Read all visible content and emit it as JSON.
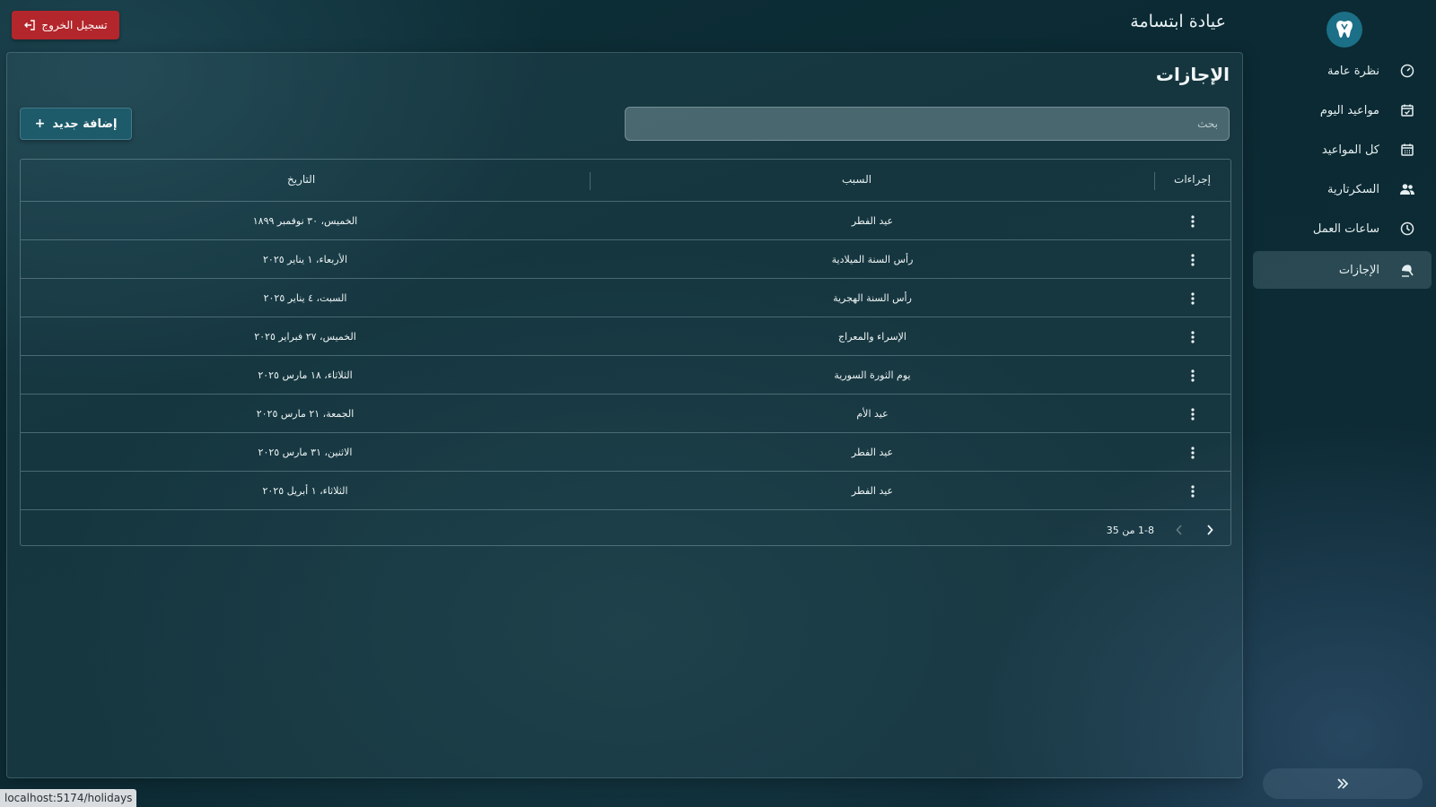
{
  "app": {
    "title": "عيادة ابتسامة",
    "logout_label": "تسجيل الخروج"
  },
  "sidebar": {
    "items": [
      {
        "label": "نظرة عامة",
        "icon": "dashboard-gauge-icon"
      },
      {
        "label": "مواعيد اليوم",
        "icon": "calendar-check-icon"
      },
      {
        "label": "كل المواعيد",
        "icon": "calendar-icon"
      },
      {
        "label": "السكرتارية",
        "icon": "people-icon"
      },
      {
        "label": "ساعات العمل",
        "icon": "clock-icon"
      },
      {
        "label": "الإجازات",
        "icon": "beach-umbrella-icon",
        "active": true
      }
    ]
  },
  "page": {
    "title": "الإجازات",
    "search_placeholder": "بحث",
    "add_label": "إضافة جديد"
  },
  "table": {
    "columns": {
      "actions": "إجراءات",
      "reason": "السبب",
      "date": "التاريخ"
    },
    "rows": [
      {
        "reason": "عيد الفطر",
        "date": "الخميس، ٣٠ نوفمبر ١٨٩٩"
      },
      {
        "reason": "رأس السنة الميلادية",
        "date": "الأربعاء، ١ يناير ٢٠٢٥"
      },
      {
        "reason": "رأس السنة الهجرية",
        "date": "السبت، ٤ يناير ٢٠٢٥"
      },
      {
        "reason": "الإسراء والمعراج",
        "date": "الخميس، ٢٧ فبراير ٢٠٢٥"
      },
      {
        "reason": "يوم الثورة السورية",
        "date": "الثلاثاء، ١٨ مارس ٢٠٢٥"
      },
      {
        "reason": "عيد الأم",
        "date": "الجمعة، ٢١ مارس ٢٠٢٥"
      },
      {
        "reason": "عيد الفطر",
        "date": "الاثنين، ٣١ مارس ٢٠٢٥"
      },
      {
        "reason": "عيد الفطر",
        "date": "الثلاثاء، ١ أبريل ٢٠٢٥"
      }
    ],
    "pagination": "1-8 من 35"
  },
  "status_bar": {
    "url": "localhost:5174/holidays"
  },
  "colors": {
    "logout": "#b3262b",
    "accent": "#1d5a6a",
    "logo_bg": "#1b6f86"
  }
}
